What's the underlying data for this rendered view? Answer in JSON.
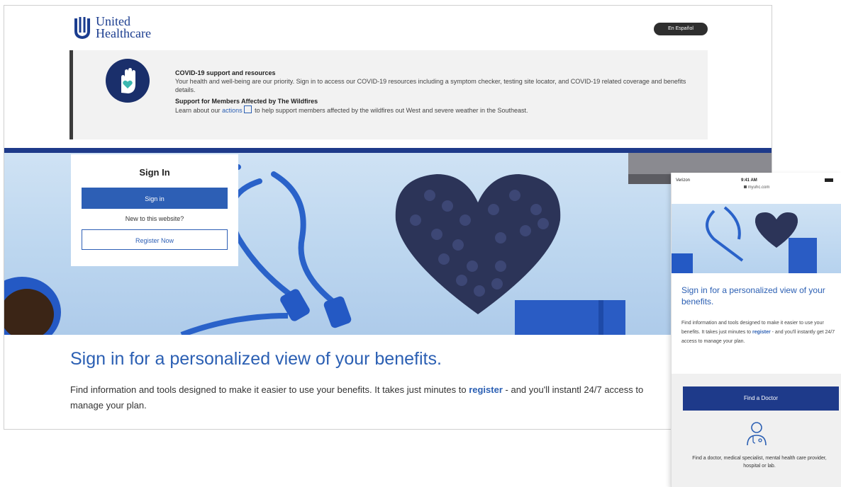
{
  "brand": {
    "logo_line1": "United",
    "logo_line2": "Healthcare",
    "colors": {
      "primary": "#1e3a8a",
      "accent": "#2d5fb5",
      "link": "#2b5fb3"
    }
  },
  "header": {
    "language_button": "En Español"
  },
  "alert": {
    "icon": "hand-heart-icon",
    "covid_title": "COVID-19 support and resources",
    "covid_body": "Your health and well-being are our priority. Sign in to access our COVID-19 resources including a symptom checker, testing site locator, and COVID-19 related coverage and benefits details.",
    "wildfire_title": "Support for Members Affected by The Wildfires",
    "wildfire_pre": "Learn about our",
    "wildfire_link": "actions",
    "wildfire_post": "to help support members affected by the wildfires out West and severe weather in the Southeast."
  },
  "signin": {
    "title": "Sign In",
    "button": "Sign in",
    "new_prompt": "New to this website?",
    "register_button": "Register Now"
  },
  "main": {
    "heading": "Sign in for a personalized view of your benefits.",
    "para_pre": "Find information and tools designed to make it easier to use your benefits. It takes just minutes to",
    "para_link": "register",
    "para_post": "- and you'll instantl 24/7 access to manage your plan."
  },
  "phone": {
    "carrier": "Verizon",
    "time": "9:41 AM",
    "url": "myuhc.com",
    "heading": "Sign in for a personalized view of your benefits.",
    "para_pre": "Find information and tools designed to make it easier to use your benefits. It takes just minutes to",
    "para_link": "register",
    "para_post": "- and you'll instantly get 24/7 access to manage your plan.",
    "find_button": "Find a Doctor",
    "card_icon": "doctor-icon",
    "card_text": "Find a doctor, medical specialist, mental health care provider, hospital or lab."
  }
}
